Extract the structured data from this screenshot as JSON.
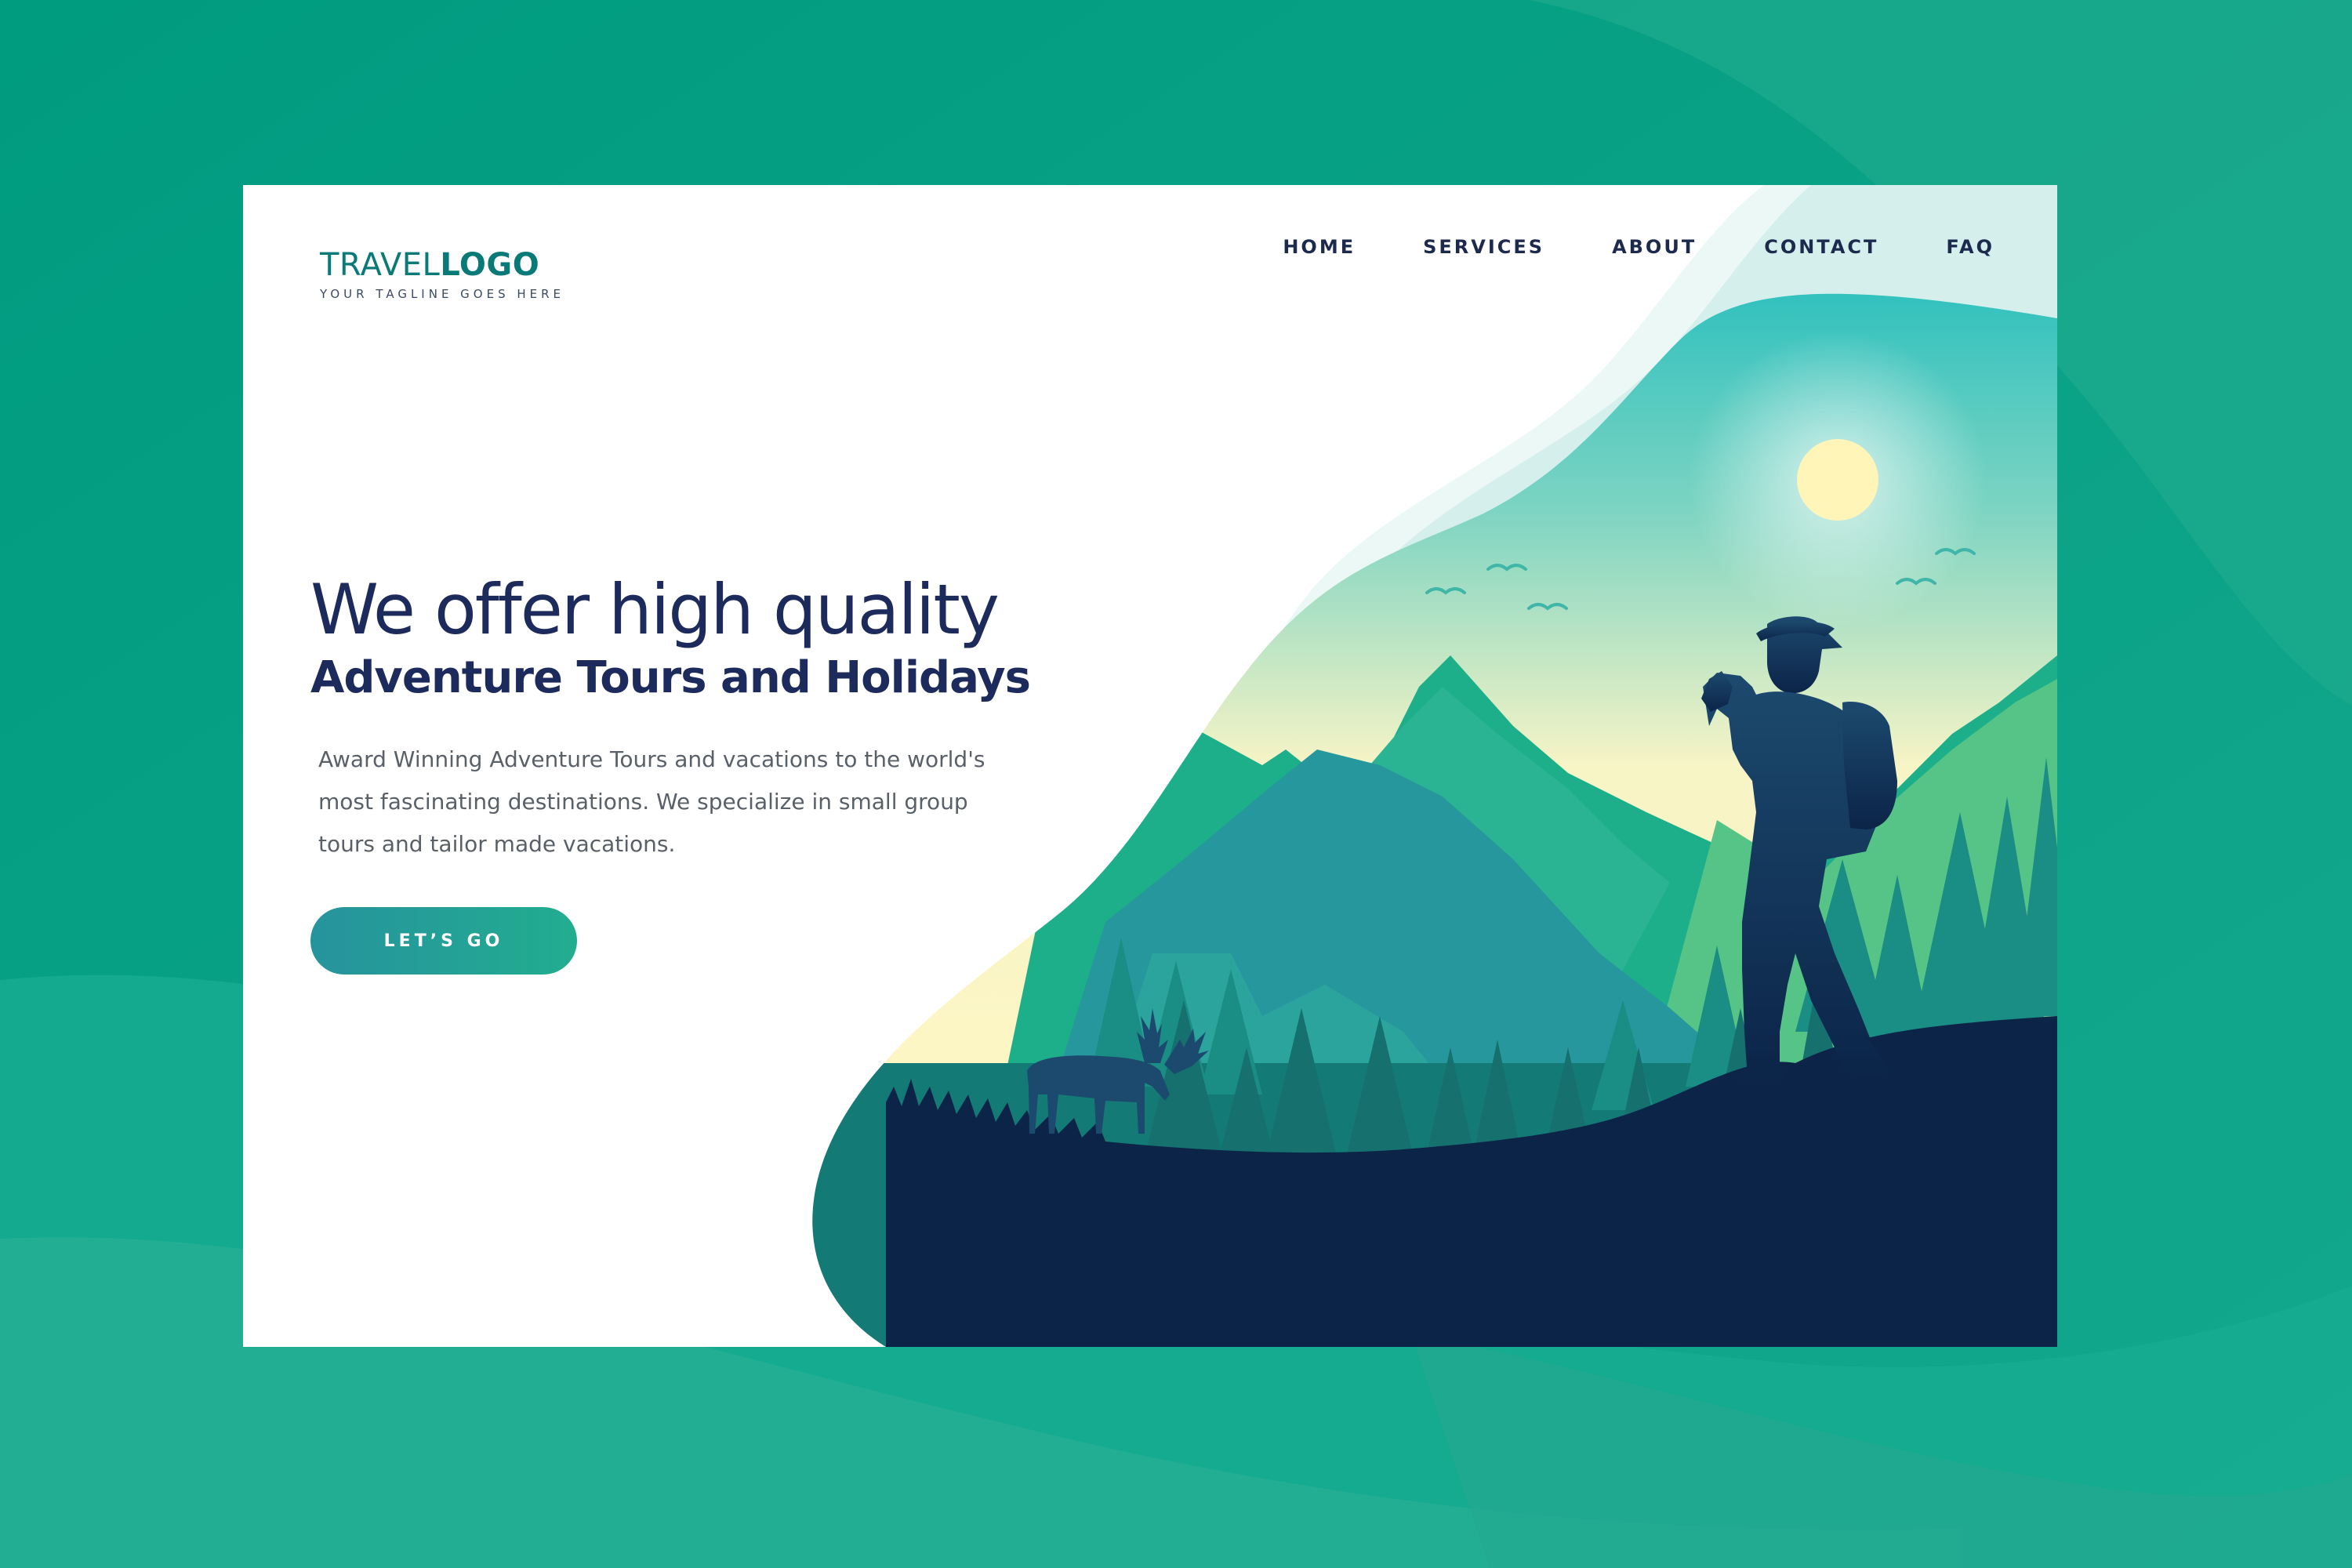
{
  "logo": {
    "word_light": "TRAVEL",
    "word_bold": "LOGO",
    "tagline": "YOUR TAGLINE GOES HERE"
  },
  "nav": {
    "items": [
      "HOME",
      "SERVICES",
      "ABOUT",
      "CONTACT",
      "FAQ"
    ]
  },
  "hero": {
    "headline_light": "We offer high quality",
    "headline_bold": "Adventure Tours and Holidays",
    "description": "Award Winning Adventure Tours and vacations to the world's most fascinating destinations. We specialize in small group tours and tailor made vacations.",
    "cta_label": "LET’S GO"
  },
  "colors": {
    "backdrop": "#0fa58a",
    "brand": "#0a7a78",
    "heading": "#1c2a5c",
    "body_text": "#5a6068",
    "silhouette": "#0b2448",
    "cta_start": "#26939d",
    "cta_end": "#22ad90"
  }
}
